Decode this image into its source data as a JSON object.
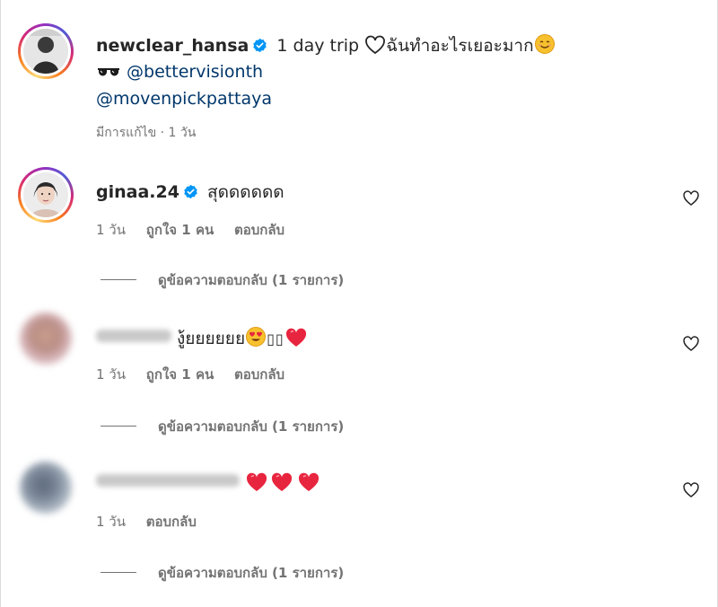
{
  "post": {
    "username": "newclear_hansa",
    "caption_text": "1 day trip",
    "caption_thai": "ฉันทำอะไรเยอะมาก",
    "mention_1": "@bettervisionth",
    "mention_2": "@movenpickpattaya",
    "meta": "มีการแก้ไข · 1 วัน"
  },
  "comments": [
    {
      "username": "ginaa.24",
      "text": "สุดดดดดด",
      "time": "1 วัน",
      "likes": "ถูกใจ 1 คน",
      "reply_label": "ตอบกลับ",
      "view_replies": "ดูข้อความตอบกลับ (1 รายการ)"
    },
    {
      "username": "",
      "text": "งู้ยยยยยย",
      "text_suffix": "▯▯",
      "time": "1 วัน",
      "likes": "ถูกใจ 1 คน",
      "reply_label": "ตอบกลับ",
      "view_replies": "ดูข้อความตอบกลับ (1 รายการ)"
    },
    {
      "username": "",
      "text": "",
      "time": "1 วัน",
      "reply_label": "ตอบกลับ",
      "view_replies": "ดูข้อความตอบกลับ (1 รายการ)"
    }
  ],
  "colors": {
    "verified": "#0095f6",
    "link": "#00376b",
    "secondary": "#737373",
    "heart_emoji": "#e8253f"
  },
  "icons": [
    "verified-badge-icon",
    "white-heart-icon",
    "sunglasses-emoji",
    "smiling-face-emoji",
    "heart-eyes-emoji",
    "heart-emoji",
    "like-heart-icon"
  ]
}
